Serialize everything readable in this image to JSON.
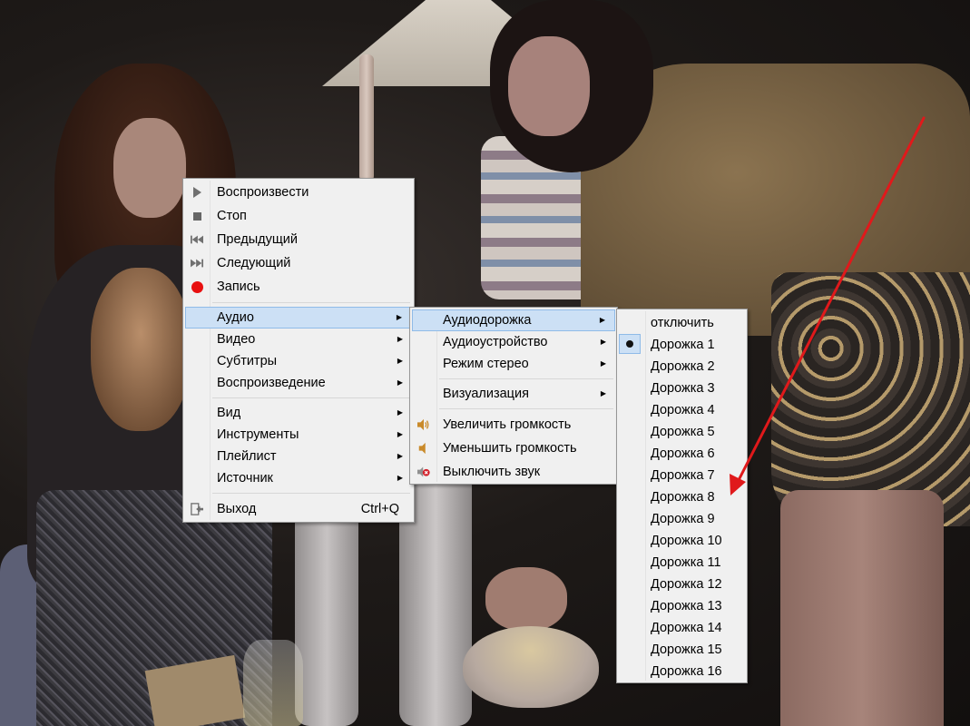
{
  "main_menu": {
    "items": [
      {
        "label": "Воспроизвести",
        "icon": "play-icon"
      },
      {
        "label": "Стоп",
        "icon": "stop-icon"
      },
      {
        "label": "Предыдущий",
        "icon": "previous-icon"
      },
      {
        "label": "Следующий",
        "icon": "next-icon"
      },
      {
        "label": "Запись",
        "icon": "record-icon"
      },
      {
        "label": "Аудио",
        "submenu": true,
        "highlighted": true
      },
      {
        "label": "Видео",
        "submenu": true
      },
      {
        "label": "Субтитры",
        "submenu": true
      },
      {
        "label": "Воспроизведение",
        "submenu": true
      },
      {
        "label": "Вид",
        "submenu": true
      },
      {
        "label": "Инструменты",
        "submenu": true
      },
      {
        "label": "Плейлист",
        "submenu": true
      },
      {
        "label": "Источник",
        "submenu": true
      },
      {
        "label": "Выход",
        "shortcut": "Ctrl+Q",
        "icon": "exit-icon"
      }
    ]
  },
  "audio_menu": {
    "items": [
      {
        "label": "Аудиодорожка",
        "submenu": true,
        "highlighted": true
      },
      {
        "label": "Аудиоустройство",
        "submenu": true
      },
      {
        "label": "Режим стерео",
        "submenu": true
      },
      {
        "label": "Визуализация",
        "submenu": true
      },
      {
        "label": "Увеличить громкость",
        "icon": "volume-up-icon"
      },
      {
        "label": "Уменьшить громкость",
        "icon": "volume-down-icon"
      },
      {
        "label": "Выключить звук",
        "icon": "mute-icon"
      }
    ]
  },
  "track_menu": {
    "selected_index": 1,
    "items": [
      "отключить",
      "Дорожка 1",
      "Дорожка 2",
      "Дорожка 3",
      "Дорожка 4",
      "Дорожка 5",
      "Дорожка 6",
      "Дорожка 7",
      "Дорожка 8",
      "Дорожка 9",
      "Дорожка 10",
      "Дорожка 11",
      "Дорожка 12",
      "Дорожка 13",
      "Дорожка 14",
      "Дорожка 15",
      "Дорожка 16"
    ]
  },
  "colors": {
    "menu_bg": "#f0f0f0",
    "highlight": "#cce0f5",
    "highlight_border": "#8fbbe8",
    "record": "#e81010",
    "annotation_arrow": "#e0191b"
  }
}
